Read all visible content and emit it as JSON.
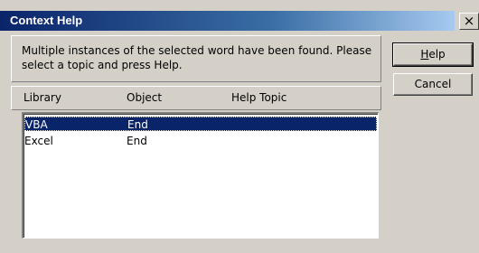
{
  "window": {
    "title": "Context Help",
    "close_glyph": "×"
  },
  "message": "Multiple instances of the selected word have been found.  Please select a topic and press Help.",
  "list": {
    "columns": [
      "Library",
      "Object",
      "Help Topic"
    ],
    "rows": [
      {
        "library": "VBA",
        "object": "End",
        "topic": "",
        "selected": true
      },
      {
        "library": "Excel",
        "object": "End",
        "topic": "",
        "selected": false
      }
    ]
  },
  "buttons": {
    "help_label": "Help",
    "help_mnemonic": "H",
    "help_rest": "elp",
    "cancel_label": "Cancel"
  },
  "colors": {
    "title_active": "#0a246a",
    "selection": "#0a246a",
    "face": "#d4d0c8"
  }
}
